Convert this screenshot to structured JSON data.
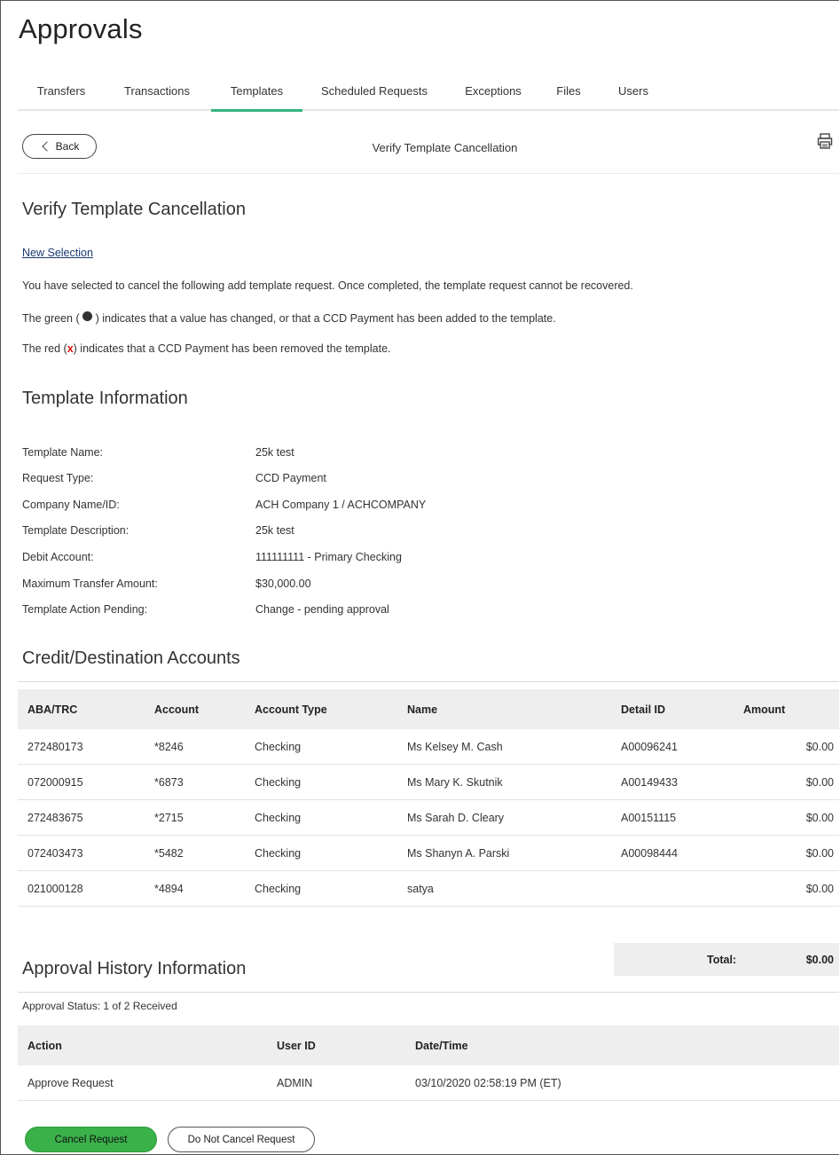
{
  "page": {
    "title": "Approvals"
  },
  "tabs": [
    {
      "label": "Transfers",
      "active": false
    },
    {
      "label": "Transactions",
      "active": false
    },
    {
      "label": "Templates",
      "active": true
    },
    {
      "label": "Scheduled Requests",
      "active": false
    },
    {
      "label": "Exceptions",
      "active": false
    },
    {
      "label": "Files",
      "active": false
    },
    {
      "label": "Users",
      "active": false
    }
  ],
  "toolbar": {
    "back_label": "Back",
    "title": "Verify Template Cancellation",
    "print_icon": "printer-icon"
  },
  "verify": {
    "heading": "Verify Template Cancellation",
    "new_selection": "New Selection",
    "intro": "You have selected to cancel the following add template request. Once completed, the template request cannot be recovered.",
    "green_before": "The green (",
    "green_after": ") indicates that a value has changed, or that a CCD Payment has been added to the template.",
    "red_before": "The red (",
    "red_mark": "x",
    "red_after": ") indicates that a CCD Payment has been removed the template."
  },
  "template_info": {
    "heading": "Template Information",
    "fields": [
      {
        "label": "Template Name:",
        "value": "25k test"
      },
      {
        "label": "Request Type:",
        "value": "CCD Payment"
      },
      {
        "label": "Company Name/ID:",
        "value": "ACH Company 1 / ACHCOMPANY"
      },
      {
        "label": "Template Description:",
        "value": "25k test"
      },
      {
        "label": "Debit Account:",
        "value": "111111111 - Primary Checking"
      },
      {
        "label": "Maximum Transfer Amount:",
        "value": "$30,000.00"
      },
      {
        "label": "Template Action Pending:",
        "value": "Change - pending approval"
      }
    ]
  },
  "credit": {
    "heading": "Credit/Destination Accounts",
    "columns": [
      "ABA/TRC",
      "Account",
      "Account Type",
      "Name",
      "Detail ID",
      "Amount"
    ],
    "rows": [
      {
        "aba": "272480173",
        "account": "*8246",
        "type": "Checking",
        "name": "Ms Kelsey M. Cash",
        "detail_id": "A00096241",
        "amount": "$0.00"
      },
      {
        "aba": "072000915",
        "account": "*6873",
        "type": "Checking",
        "name": "Ms Mary K. Skutnik",
        "detail_id": "A00149433",
        "amount": "$0.00"
      },
      {
        "aba": "272483675",
        "account": "*2715",
        "type": "Checking",
        "name": "Ms Sarah D. Cleary",
        "detail_id": "A00151115",
        "amount": "$0.00"
      },
      {
        "aba": "072403473",
        "account": "*5482",
        "type": "Checking",
        "name": "Ms Shanyn A. Parski",
        "detail_id": "A00098444",
        "amount": "$0.00"
      },
      {
        "aba": "021000128",
        "account": "*4894",
        "type": "Checking",
        "name": "satya",
        "detail_id": "",
        "amount": "$0.00"
      }
    ],
    "total_label": "Total:",
    "total_value": "$0.00"
  },
  "history": {
    "heading": "Approval History Information",
    "status": "Approval Status: 1 of 2 Received",
    "columns": [
      "Action",
      "User ID",
      "Date/Time"
    ],
    "rows": [
      {
        "action": "Approve Request",
        "user_id": "ADMIN",
        "datetime": "03/10/2020 02:58:19 PM (ET)"
      }
    ]
  },
  "actions": {
    "cancel_label": "Cancel Request",
    "dont_cancel_label": "Do Not Cancel Request"
  },
  "colors": {
    "accent_green": "#36b37e",
    "button_green": "#3bb14a",
    "remove_red": "#dd1111",
    "link_blue": "#1a3a73"
  }
}
